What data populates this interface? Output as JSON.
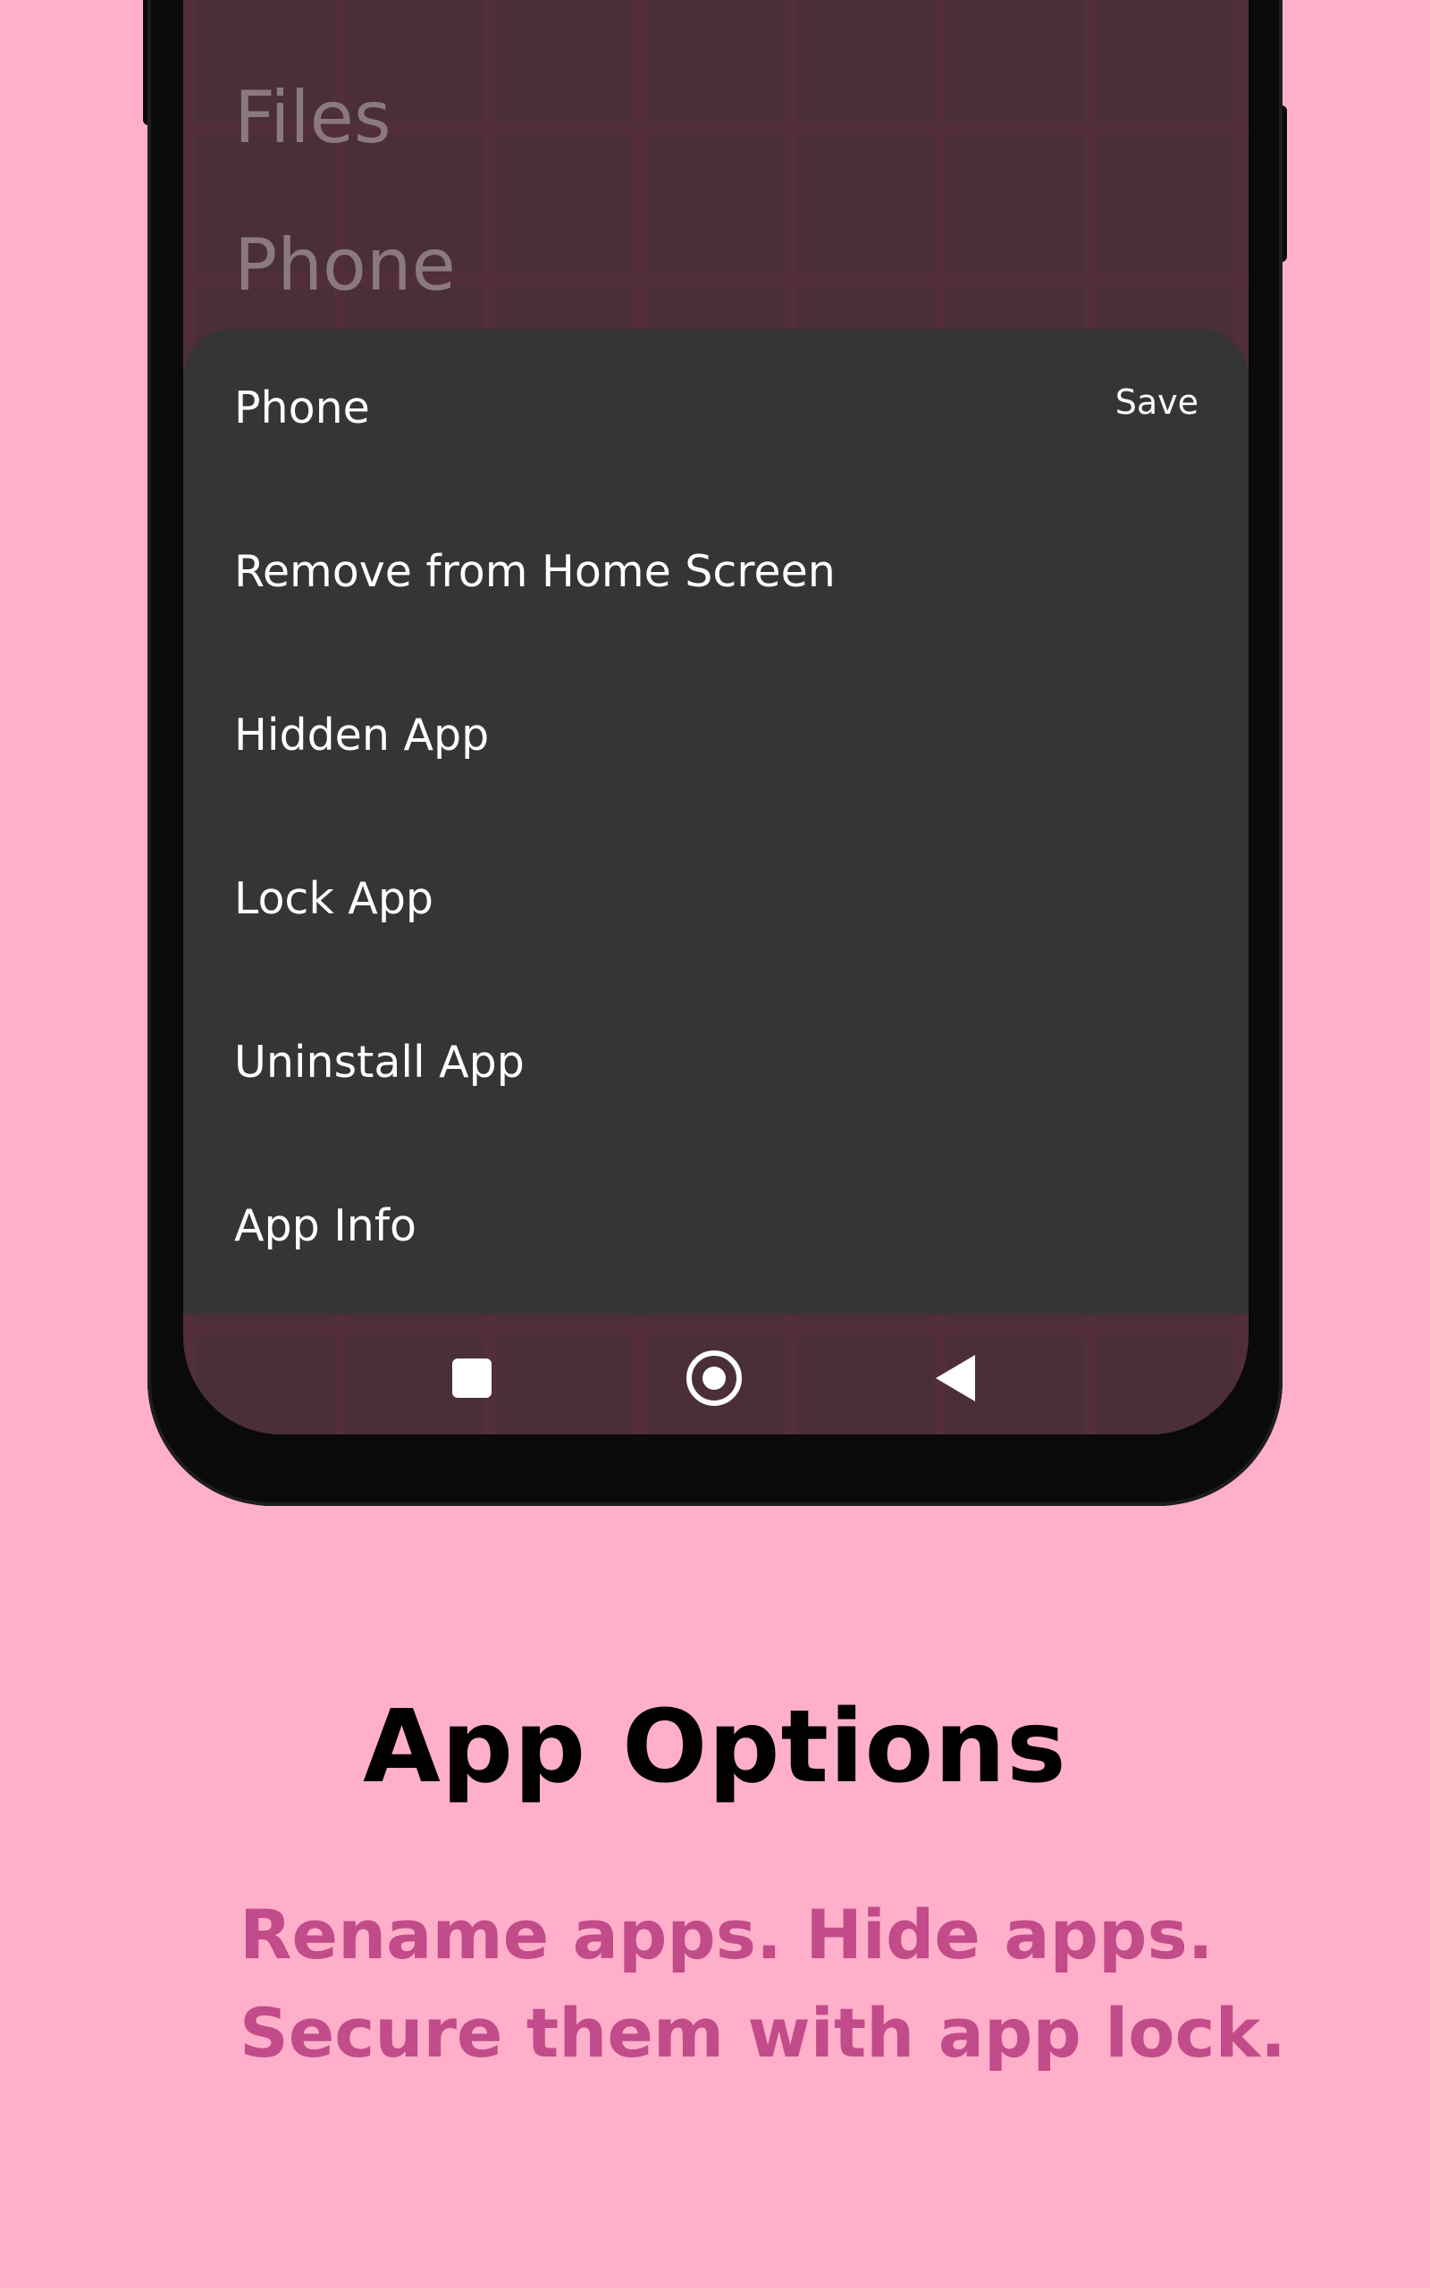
{
  "colors": {
    "background": "#FFAFCA",
    "sheet": "#353535",
    "screen": "#4a2f39",
    "heading": "#000000",
    "subtext": "#C24B89"
  },
  "background_list": {
    "items": [
      "Files",
      "Phone"
    ]
  },
  "sheet": {
    "title": "Phone",
    "save_label": "Save",
    "options": [
      "Remove from Home Screen",
      "Hidden App",
      "Lock App",
      "Uninstall App",
      "App Info"
    ]
  },
  "navbar": {
    "icons": [
      "recents-icon",
      "home-icon",
      "back-icon"
    ]
  },
  "caption": {
    "title": "App Options",
    "lines": [
      "Rename apps. Hide apps.",
      "Secure them with app lock."
    ]
  }
}
